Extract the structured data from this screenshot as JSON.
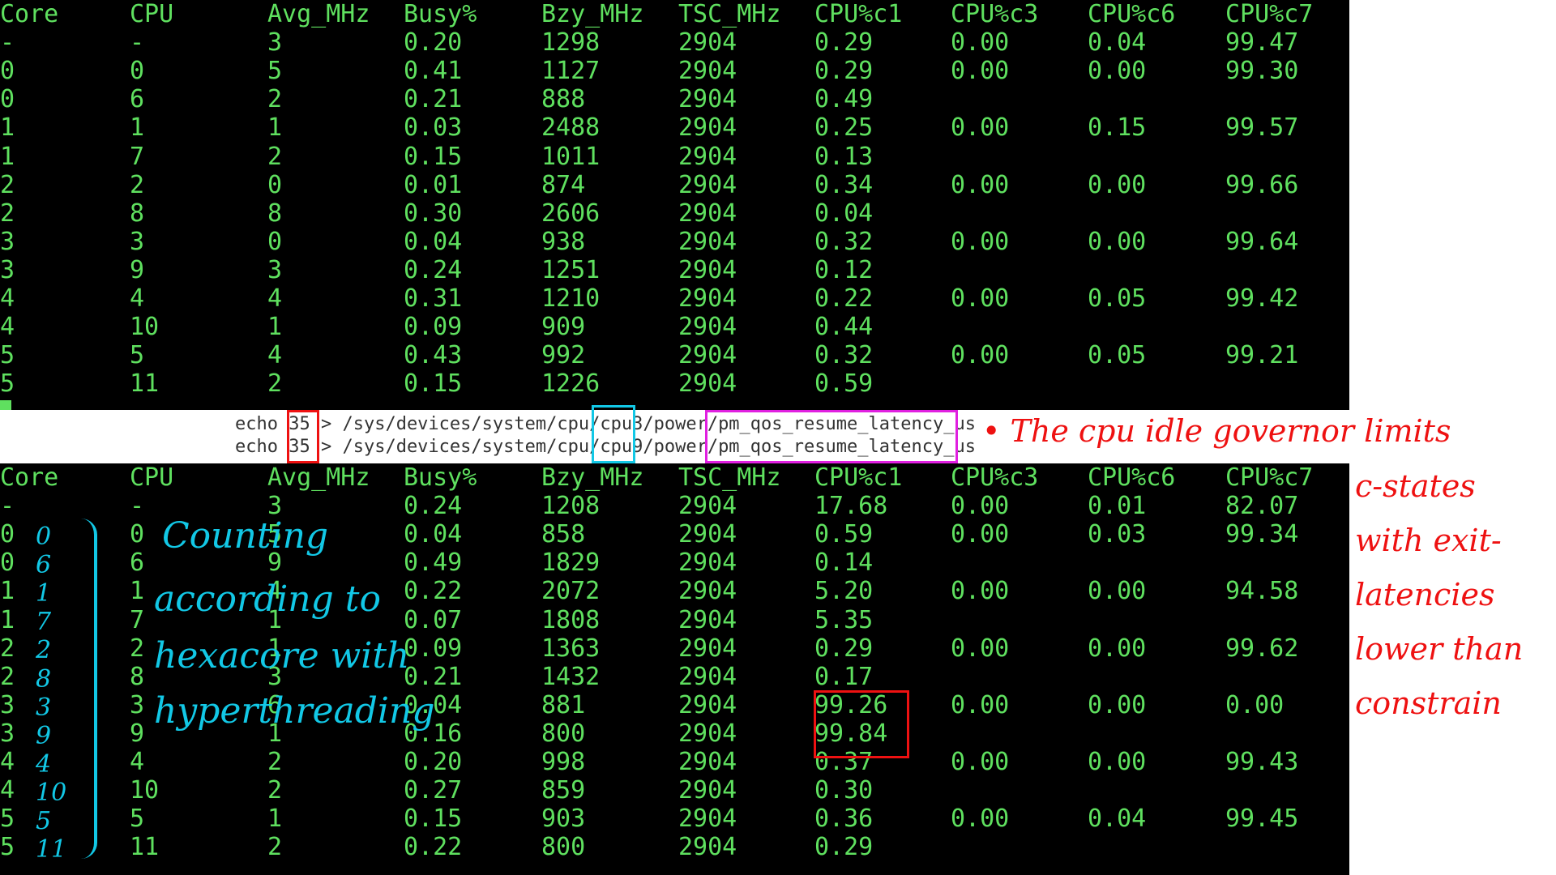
{
  "headers": [
    "Core",
    "CPU",
    "Avg_MHz",
    "Busy%",
    "Bzy_MHz",
    "TSC_MHz",
    "CPU%c1",
    "CPU%c3",
    "CPU%c6",
    "CPU%c7"
  ],
  "top_rows": [
    [
      "-",
      "-",
      "3",
      "0.20",
      "1298",
      "2904",
      "0.29",
      "0.00",
      "0.04",
      "99.47"
    ],
    [
      "0",
      "0",
      "5",
      "0.41",
      "1127",
      "2904",
      "0.29",
      "0.00",
      "0.00",
      "99.30"
    ],
    [
      "0",
      "6",
      "2",
      "0.21",
      "888",
      "2904",
      "0.49",
      "",
      "",
      ""
    ],
    [
      "1",
      "1",
      "1",
      "0.03",
      "2488",
      "2904",
      "0.25",
      "0.00",
      "0.15",
      "99.57"
    ],
    [
      "1",
      "7",
      "2",
      "0.15",
      "1011",
      "2904",
      "0.13",
      "",
      "",
      ""
    ],
    [
      "2",
      "2",
      "0",
      "0.01",
      "874",
      "2904",
      "0.34",
      "0.00",
      "0.00",
      "99.66"
    ],
    [
      "2",
      "8",
      "8",
      "0.30",
      "2606",
      "2904",
      "0.04",
      "",
      "",
      ""
    ],
    [
      "3",
      "3",
      "0",
      "0.04",
      "938",
      "2904",
      "0.32",
      "0.00",
      "0.00",
      "99.64"
    ],
    [
      "3",
      "9",
      "3",
      "0.24",
      "1251",
      "2904",
      "0.12",
      "",
      "",
      ""
    ],
    [
      "4",
      "4",
      "4",
      "0.31",
      "1210",
      "2904",
      "0.22",
      "0.00",
      "0.05",
      "99.42"
    ],
    [
      "4",
      "10",
      "1",
      "0.09",
      "909",
      "2904",
      "0.44",
      "",
      "",
      ""
    ],
    [
      "5",
      "5",
      "4",
      "0.43",
      "992",
      "2904",
      "0.32",
      "0.00",
      "0.05",
      "99.21"
    ],
    [
      "5",
      "11",
      "2",
      "0.15",
      "1226",
      "2904",
      "0.59",
      "",
      "",
      ""
    ]
  ],
  "bottom_rows": [
    [
      "-",
      "-",
      "3",
      "0.24",
      "1208",
      "2904",
      "17.68",
      "0.00",
      "0.01",
      "82.07"
    ],
    [
      "0",
      "0",
      "5",
      "0.04",
      "858",
      "2904",
      "0.59",
      "0.00",
      "0.03",
      "99.34"
    ],
    [
      "0",
      "6",
      "9",
      "0.49",
      "1829",
      "2904",
      "0.14",
      "",
      "",
      ""
    ],
    [
      "1",
      "1",
      "4",
      "0.22",
      "2072",
      "2904",
      "5.20",
      "0.00",
      "0.00",
      "94.58"
    ],
    [
      "1",
      "7",
      "1",
      "0.07",
      "1808",
      "2904",
      "5.35",
      "",
      "",
      ""
    ],
    [
      "2",
      "2",
      "1",
      "0.09",
      "1363",
      "2904",
      "0.29",
      "0.00",
      "0.00",
      "99.62"
    ],
    [
      "2",
      "8",
      "3",
      "0.21",
      "1432",
      "2904",
      "0.17",
      "",
      "",
      ""
    ],
    [
      "3",
      "3",
      "6",
      "0.04",
      "881",
      "2904",
      "99.26",
      "0.00",
      "0.00",
      "0.00"
    ],
    [
      "3",
      "9",
      "1",
      "0.16",
      "800",
      "2904",
      "99.84",
      "",
      "",
      ""
    ],
    [
      "4",
      "4",
      "2",
      "0.20",
      "998",
      "2904",
      "0.37",
      "0.00",
      "0.00",
      "99.43"
    ],
    [
      "4",
      "10",
      "2",
      "0.27",
      "859",
      "2904",
      "0.30",
      "",
      "",
      ""
    ],
    [
      "5",
      "5",
      "1",
      "0.15",
      "903",
      "2904",
      "0.36",
      "0.00",
      "0.04",
      "99.45"
    ],
    [
      "5",
      "11",
      "2",
      "0.22",
      "800",
      "2904",
      "0.29",
      "",
      "",
      ""
    ]
  ],
  "commands": [
    {
      "pre": "echo ",
      "value": "35",
      "mid": " > /sys/devices/system/cpu/",
      "cpu": "cpu3",
      "path": "/power/",
      "attr": "pm_qos_resume_latency_us"
    },
    {
      "pre": "echo ",
      "value": "35",
      "mid": " > /sys/devices/system/cpu/",
      "cpu": "cpu9",
      "path": "/power/",
      "attr": "pm_qos_resume_latency_us"
    }
  ],
  "annotations": {
    "right": [
      "• The cpu idle governor limits",
      "c-states",
      "with exit-",
      "latencies",
      "lower than",
      "constrain"
    ],
    "left": [
      "Counting",
      "according to",
      "hexacore with",
      "hyperthreading"
    ],
    "left_numbers": [
      "0",
      "6",
      "1",
      "7",
      "2",
      "8",
      "3",
      "9",
      "4",
      "10",
      "5",
      "11"
    ]
  },
  "colors": {
    "terminal_text": "#5fe05f",
    "terminal_bg": "#000000",
    "red": "#ee1111",
    "cyan": "#12c8e6",
    "magenta": "#e020e0"
  }
}
